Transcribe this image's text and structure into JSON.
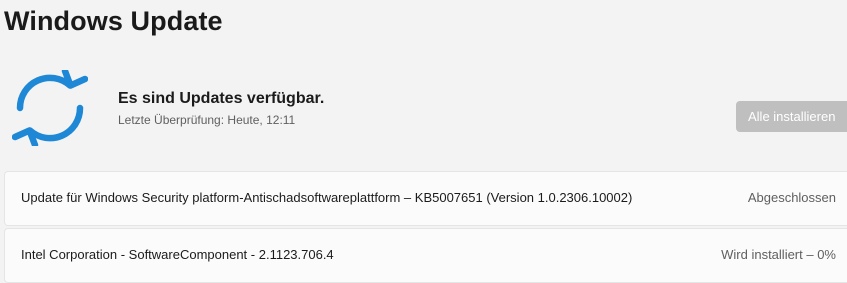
{
  "page": {
    "title": "Windows Update"
  },
  "status": {
    "icon": "sync-arrows-icon",
    "heading": "Es sind Updates verfügbar.",
    "last_check": "Letzte Überprüfung: Heute, 12:11",
    "install_all_label": "Alle installieren"
  },
  "updates": [
    {
      "name": "Update für Windows Security platform-Antischadsoftwareplattform – KB5007651 (Version 1.0.2306.10002)",
      "status": "Abgeschlossen"
    },
    {
      "name": "Intel Corporation - SoftwareComponent - 2.1123.706.4",
      "status": "Wird installiert – 0%",
      "progress_percent": 0
    }
  ],
  "colors": {
    "accent": "#1e88d6",
    "disabled_button": "#bfbfbf"
  }
}
